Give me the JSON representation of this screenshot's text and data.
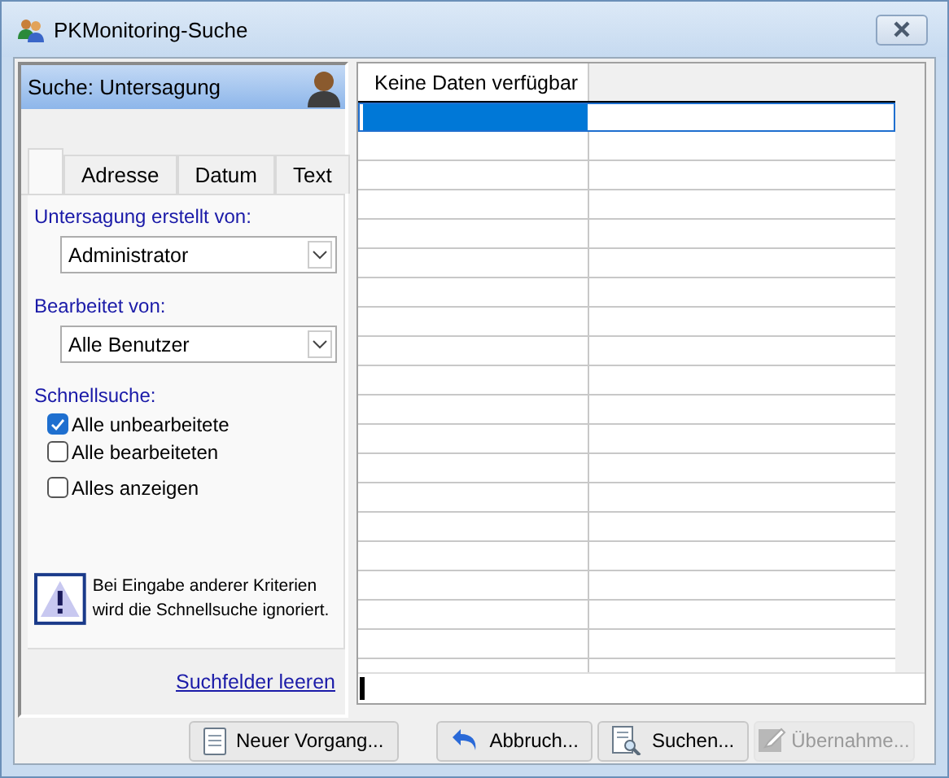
{
  "window": {
    "title": "PKMonitoring-Suche"
  },
  "search_panel": {
    "title": "Suche: Untersagung",
    "tabs": [
      {
        "selected": true
      },
      {
        "label": "Adresse",
        "selected": false
      },
      {
        "label": "Datum",
        "selected": false
      },
      {
        "label": "Text",
        "selected": false
      }
    ],
    "dropdowns": [
      {
        "label": "Untersagung erstellt von:",
        "value": "Administrator"
      },
      {
        "label": "Bearbeitet von:",
        "value": "Alle Benutzer"
      }
    ],
    "quick_search": {
      "label": "Schnellsuche:",
      "options": [
        {
          "label": "Alle unbearbeitete",
          "checked": true
        },
        {
          "label": "Alle bearbeiteten",
          "checked": false
        },
        {
          "label": "Alles anzeigen",
          "checked": false
        }
      ]
    },
    "notice": "Bei Eingabe anderer Kriterien wird die Schnellsuche ignoriert.",
    "clear_link": "Suchfelder leeren"
  },
  "grid": {
    "columns": [
      "Keine Daten verfügbar"
    ],
    "rows": [
      {
        "selected": true
      },
      {
        "selected": false
      },
      {
        "selected": false
      },
      {
        "selected": false
      },
      {
        "selected": false
      },
      {
        "selected": false
      },
      {
        "selected": false
      },
      {
        "selected": false
      },
      {
        "selected": false
      },
      {
        "selected": false
      },
      {
        "selected": false
      },
      {
        "selected": false
      },
      {
        "selected": false
      },
      {
        "selected": false
      },
      {
        "selected": false
      },
      {
        "selected": false
      },
      {
        "selected": false
      },
      {
        "selected": false
      },
      {
        "selected": false
      },
      {
        "selected": false
      }
    ]
  },
  "buttons": [
    {
      "label": "Neuer Vorgang...",
      "kind": "new",
      "disabled": false
    },
    {
      "label": "Abbruch...",
      "kind": "undo",
      "disabled": false
    },
    {
      "label": "Suchen...",
      "kind": "search",
      "disabled": false
    },
    {
      "label": "Übernahme...",
      "kind": "apply",
      "disabled": true
    }
  ]
}
